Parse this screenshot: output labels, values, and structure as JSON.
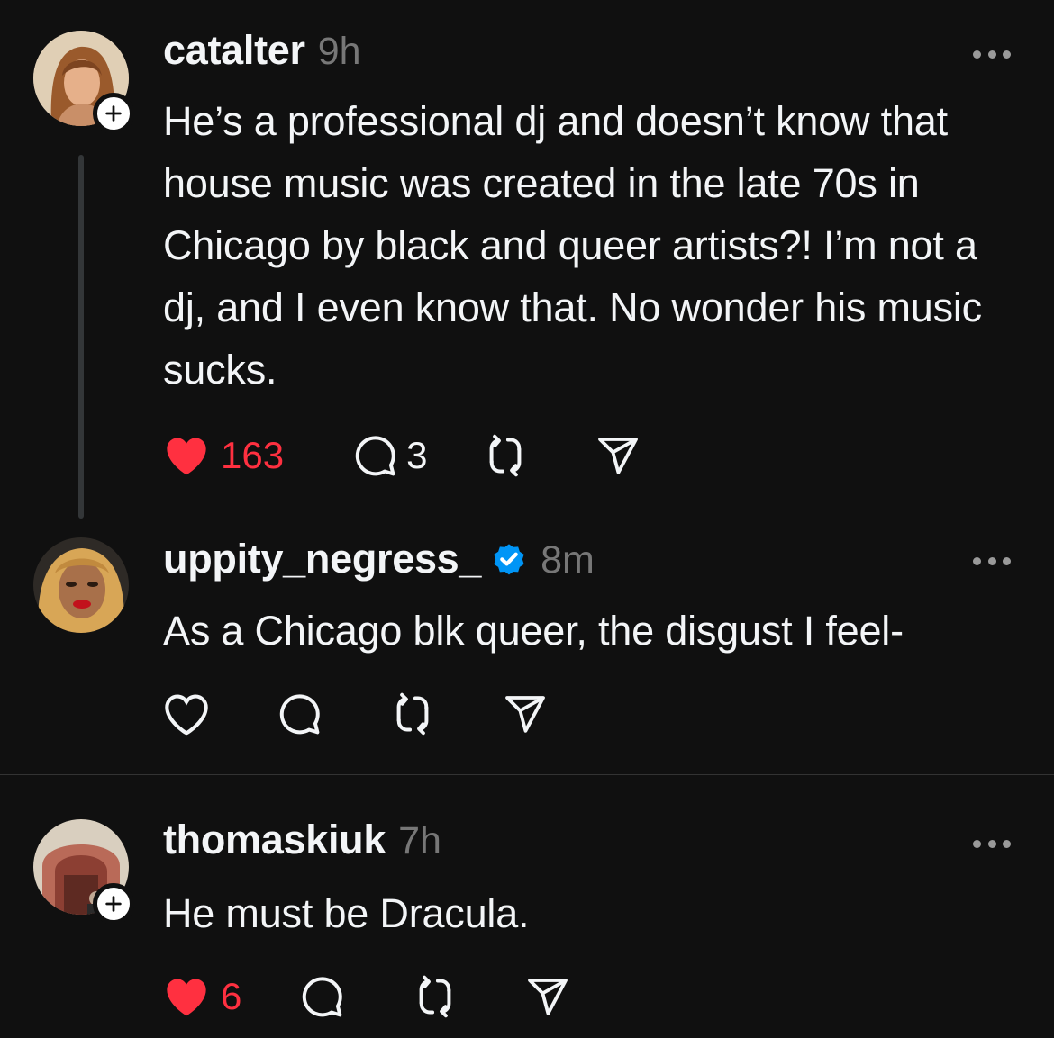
{
  "colors": {
    "background": "#101010",
    "text": "#f3f5f7",
    "muted": "#777777",
    "like": "#ff3040",
    "verified": "#0095f6"
  },
  "posts": [
    {
      "username": "catalter",
      "timestamp": "9h",
      "text": "He’s a professional dj and doesn’t know that house music was created in the late 70s in Chicago by black and queer artists?! I’m not a dj, and I even know that. No wonder his music sucks.",
      "like_count": "163",
      "reply_count": "3",
      "liked": true,
      "verified": false,
      "follow_badge": true,
      "icons": [
        "heart-filled-icon",
        "comment-icon",
        "repost-icon",
        "share-icon",
        "more-icon",
        "plus-icon"
      ]
    },
    {
      "username": "uppity_negress_",
      "timestamp": "8m",
      "text": "As a Chicago blk queer, the disgust I feel-",
      "liked": false,
      "verified": true,
      "follow_badge": false,
      "icons": [
        "heart-outline-icon",
        "comment-icon",
        "repost-icon",
        "share-icon",
        "more-icon",
        "verified-icon"
      ]
    },
    {
      "username": "thomaskiuk",
      "timestamp": "7h",
      "text": "He must be Dracula.",
      "like_count": "6",
      "liked": true,
      "verified": false,
      "follow_badge": true,
      "icons": [
        "heart-filled-icon",
        "comment-icon",
        "repost-icon",
        "share-icon",
        "more-icon",
        "plus-icon"
      ]
    }
  ]
}
